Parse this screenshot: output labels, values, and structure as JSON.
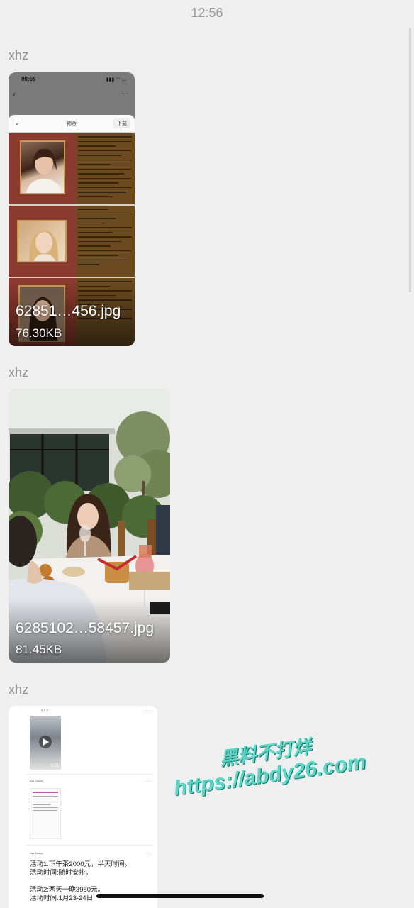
{
  "status_bar": {
    "time": "12:56"
  },
  "messages": [
    {
      "sender": "xhz",
      "file_name": "62851…456.jpg",
      "file_size": "76.30KB",
      "preview": {
        "time": "00:59",
        "sheet_title": "预览",
        "download_label": "下载"
      }
    },
    {
      "sender": "xhz",
      "file_name": "6285102…58457.jpg",
      "file_size": "81.45KB"
    },
    {
      "sender": "xhz",
      "preview": {
        "video_duration": "0:35",
        "line1": "活动1:下午茶2000元，半天时间。",
        "line2": "活动时间:随时安排。",
        "line3": "活动2:两天一晚3980元。",
        "line4": "活动时间:1月23-24日"
      }
    }
  ],
  "watermark": {
    "line1": "黑料不打烊",
    "line2": "https://abdy26.com"
  },
  "colors": {
    "background": "#efefef",
    "sender_text": "#8e8e8e",
    "watermark": "#5fd3c4"
  }
}
